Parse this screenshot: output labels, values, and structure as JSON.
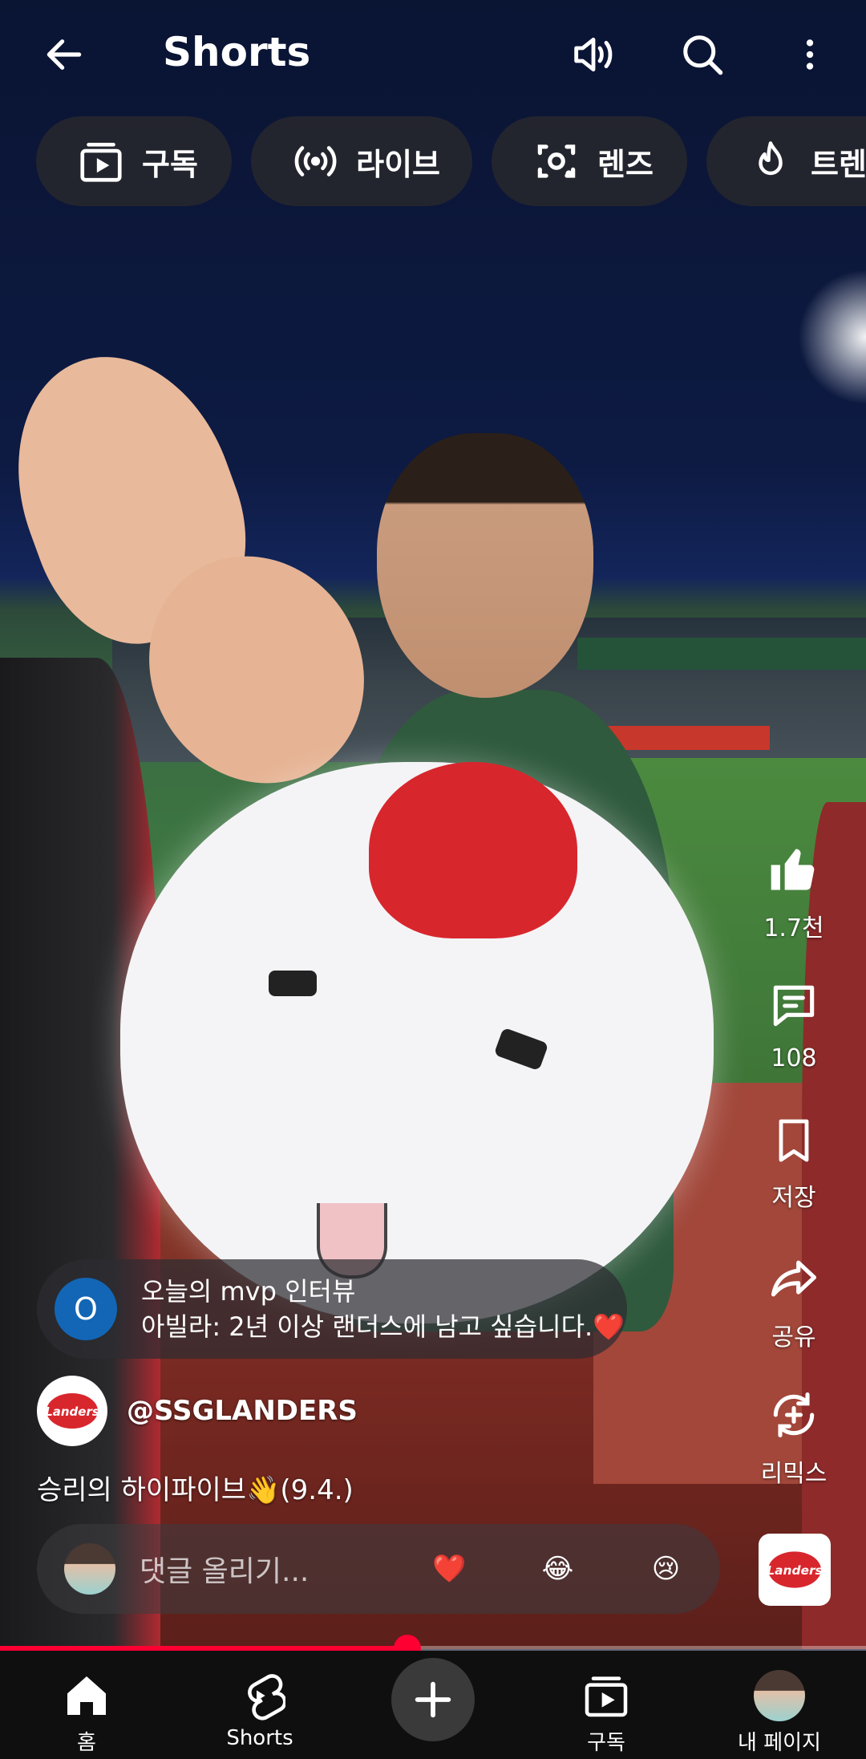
{
  "header": {
    "title": "Shorts",
    "back_icon": "arrow-left-icon",
    "sound_icon": "speaker-icon",
    "search_icon": "search-icon",
    "more_icon": "more-vertical-icon"
  },
  "chips": [
    {
      "label": "구독",
      "icon": "subscriptions-icon"
    },
    {
      "label": "라이브",
      "icon": "live-icon"
    },
    {
      "label": "렌즈",
      "icon": "lens-icon"
    },
    {
      "label": "트렌",
      "icon": "trending-icon"
    }
  ],
  "actions": {
    "like": {
      "label": "1.7천",
      "icon": "thumbs-up-icon"
    },
    "comment": {
      "label": "108",
      "icon": "comment-icon"
    },
    "save": {
      "label": "저장",
      "icon": "bookmark-icon"
    },
    "share": {
      "label": "공유",
      "icon": "share-icon"
    },
    "remix": {
      "label": "리믹스",
      "icon": "remix-icon"
    }
  },
  "pinned_comment": {
    "badge": "O",
    "line1": "오늘의 mvp 인터뷰",
    "line2": "아빌라: 2년 이상 랜더스에 남고 싶습니다.❤️"
  },
  "channel": {
    "handle": "@SSGLANDERS",
    "logo_text": "Landers"
  },
  "caption": "승리의 하이파이브👋(9.4.)",
  "comment_bar": {
    "placeholder": "댓글 올리기...",
    "emojis": [
      "❤️",
      "😂",
      "😢"
    ]
  },
  "progress": {
    "fraction": 0.47
  },
  "bottom_nav": [
    {
      "label": "홈",
      "icon": "home-icon"
    },
    {
      "label": "Shorts",
      "icon": "shorts-icon"
    },
    {
      "label": "",
      "icon": "add-icon"
    },
    {
      "label": "구독",
      "icon": "subscriptions-icon"
    },
    {
      "label": "내 페이지",
      "icon": "profile-avatar"
    }
  ],
  "colors": {
    "accent": "#ff0033",
    "pinned_badge": "#1266b5",
    "nav_bg": "#0f0f0f"
  }
}
